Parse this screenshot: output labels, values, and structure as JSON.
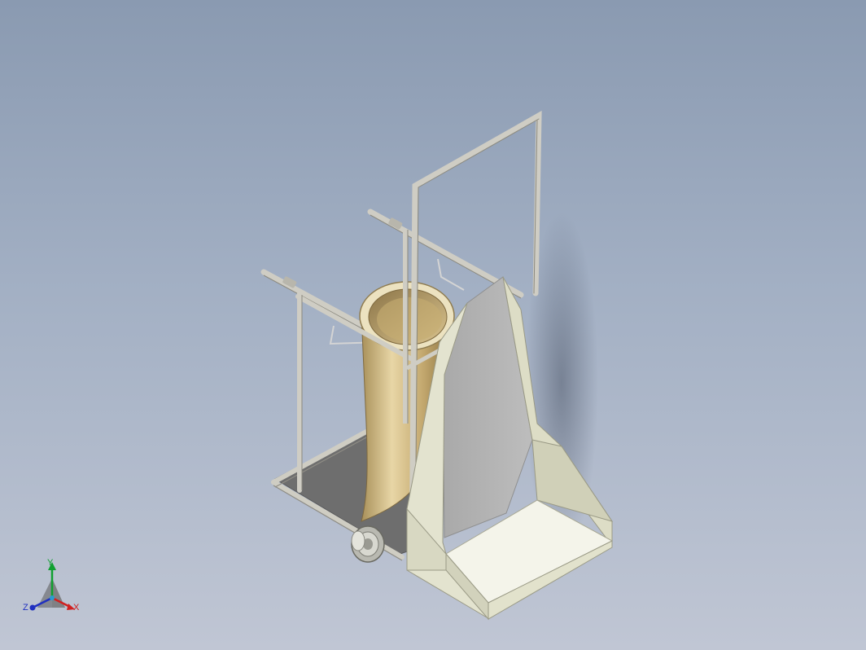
{
  "viewport": {
    "background_top": "#8a9ab1",
    "background_bottom": "#c0c6d4"
  },
  "model": {
    "frame_color": "#c8c6bc",
    "bucket_color": "#c9b07a",
    "shell_color": "#e6e6d4",
    "base_plate_color": "#6e6e6e"
  },
  "triad": {
    "x_label": "X",
    "y_label": "Y",
    "z_label": "Z",
    "x_color": "#d02020",
    "y_color": "#10a030",
    "z_color": "#2030c0"
  }
}
